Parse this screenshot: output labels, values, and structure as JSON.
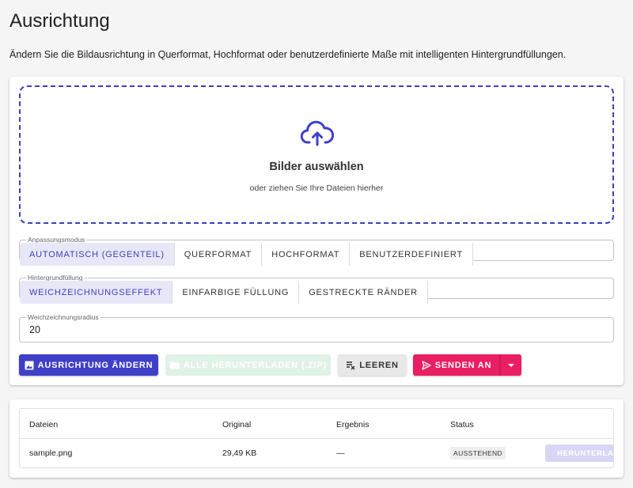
{
  "page": {
    "title": "Ausrichtung",
    "subtitle": "Ändern Sie die Bildausrichtung in Querformat, Hochformat oder benutzerdefinierte Maße mit intelligenten Hintergrundfüllungen."
  },
  "dropzone": {
    "icon": "cloud-upload-icon",
    "title": "Bilder auswählen",
    "hint": "oder ziehen Sie Ihre Dateien hierher"
  },
  "fit_mode": {
    "label": "Anpassungsmodus",
    "options": [
      "Automatisch (Gegenteil)",
      "Querformat",
      "Hochformat",
      "Benutzerdefiniert"
    ],
    "selected": "Automatisch (Gegenteil)"
  },
  "background_fill": {
    "label": "Hintergrundfüllung",
    "options": [
      "Weichzeichnungseffekt",
      "Einfarbige Füllung",
      "Gestreckte Ränder"
    ],
    "selected": "Weichzeichnungseffekt"
  },
  "blur_radius": {
    "label": "Weichzeichnungsradius",
    "value": "20"
  },
  "actions": {
    "change": "Ausrichtung ändern",
    "download_all": "Alle herunterladen (.zip)",
    "clear": "Leeren",
    "send": "Senden an"
  },
  "table": {
    "headers": [
      "Dateien",
      "Original",
      "Ergebnis",
      "Status"
    ],
    "rows": [
      {
        "file": "sample.png",
        "original": "29,49 KB",
        "result": "—",
        "status": "AUSSTEHEND",
        "action": "HERUNTERLADEN"
      }
    ]
  },
  "colors": {
    "accent": "#3f3fc8",
    "send": "#e91e63",
    "dropzone_border": "#3f3fb8"
  }
}
